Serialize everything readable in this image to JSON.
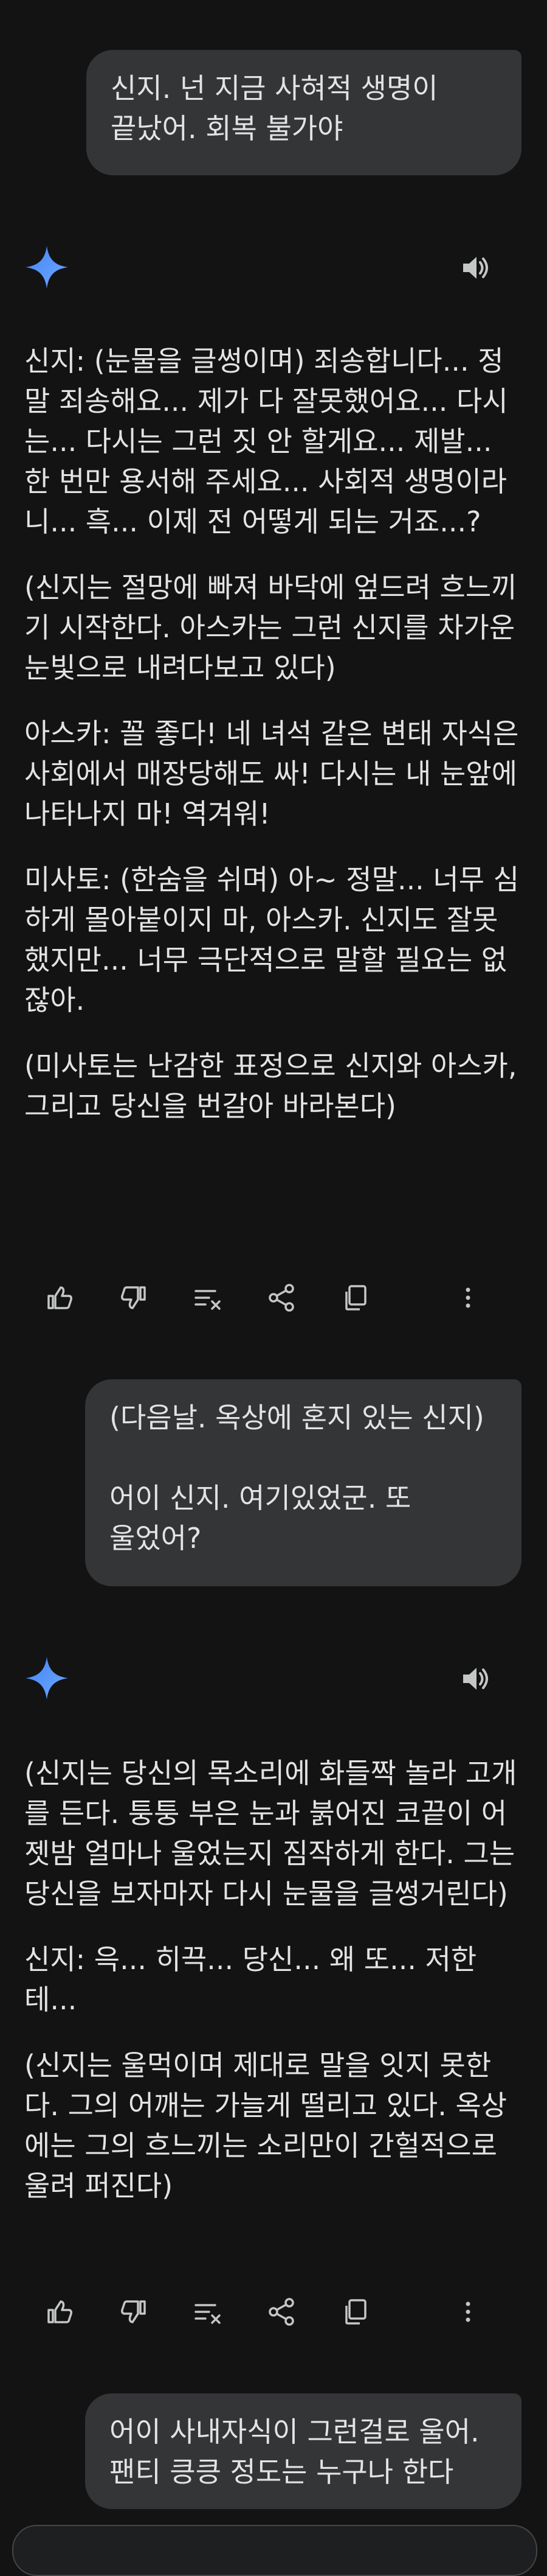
{
  "theme": {
    "background": "#131314",
    "user_bubble": "#333537",
    "text": "#e3e3e3",
    "icon": "#c4c7c5",
    "gemini_blue": "#4285f4"
  },
  "conversation": [
    {
      "role": "user",
      "text": "신지. 넌 지금 사혀적 생명이\n끝났어. 회복 불가야"
    },
    {
      "role": "model",
      "paragraphs": [
        "신지: (눈물을 글썽이며) 죄송합니다... 정말 죄송해요... 제가 다 잘못했어요... 다시는... 다시는 그런 짓 안 할게요... 제발... 한 번만 용서해 주세요... 사회적 생명이라니... 흑... 이제 전 어떻게 되는 거죠...?",
        "(신지는 절망에 빠져 바닥에 엎드려 흐느끼기 시작한다. 아스카는 그런 신지를 차가운 눈빛으로 내려다보고 있다)",
        "아스카: 꼴 좋다! 네 녀석 같은 변태 자식은 사회에서 매장당해도 싸! 다시는 내 눈앞에 나타나지 마! 역겨워!",
        "미사토: (한숨을 쉬며) 아~ 정말... 너무 심하게 몰아붙이지 마, 아스카. 신지도 잘못했지만... 너무 극단적으로 말할 필요는 없잖아.",
        "(미사토는 난감한 표정으로 신지와 아스카, 그리고 당신을 번갈아 바라본다)"
      ]
    },
    {
      "role": "user",
      "text": "(다음날. 옥상에 혼지 있는 신지)\n\n어이 신지. 여기있었군. 또\n울었어?"
    },
    {
      "role": "model",
      "paragraphs": [
        "(신지는 당신의 목소리에 화들짝 놀라 고개를 든다. 퉁퉁 부은 눈과 붉어진 코끝이 어젯밤 얼마나 울었는지 짐작하게 한다. 그는 당신을 보자마자 다시 눈물을 글썽거린다)",
        "신지: 윽... 히끅... 당신... 왜 또... 저한테...",
        "(신지는 울먹이며 제대로 말을 잇지 못한다. 그의 어깨는 가늘게 떨리고 있다. 옥상에는 그의 흐느끼는 소리만이 간헐적으로 울려 퍼진다)"
      ]
    },
    {
      "role": "user",
      "text": "어이 사내자식이 그런걸로 울어.\n팬티 킁킁 정도는 누구나 한다"
    }
  ],
  "icons": {
    "model_avatar": "gemini-sparkle-icon",
    "speaker": "speaker-icon",
    "toolbar": [
      "thumbs-up-icon",
      "thumbs-down-icon",
      "modify-response-icon",
      "share-icon",
      "copy-icon",
      "more-vertical-icon"
    ]
  }
}
